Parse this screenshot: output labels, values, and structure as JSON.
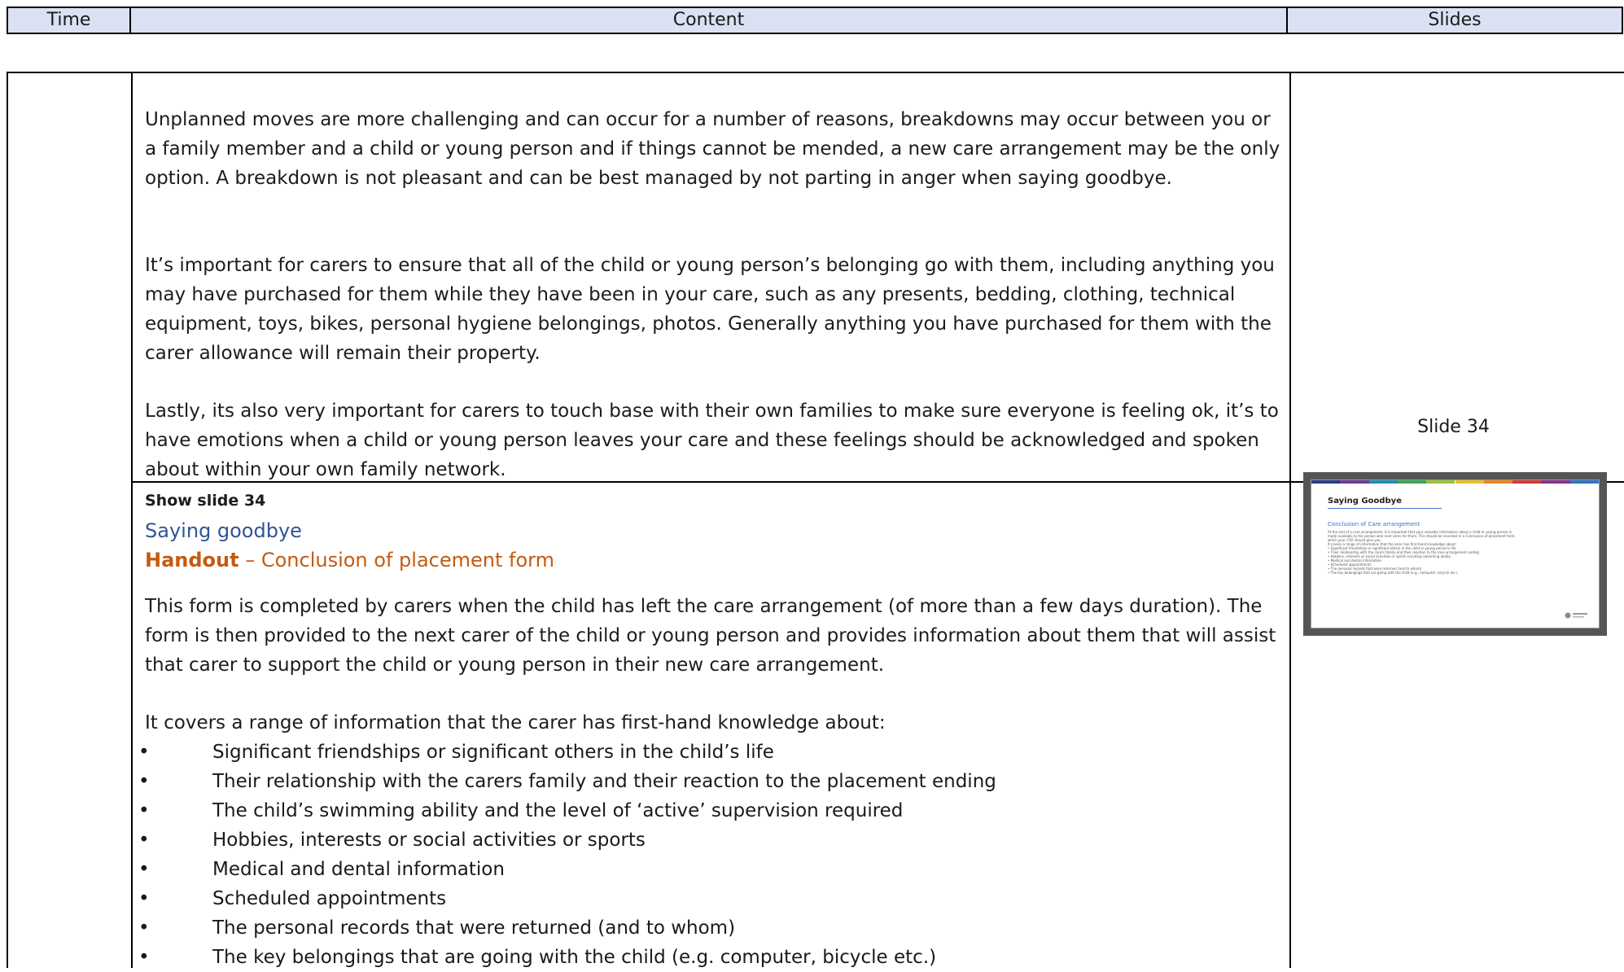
{
  "header": {
    "time": "Time",
    "content": "Content",
    "slides": "Slides"
  },
  "row1": {
    "p1": "Unplanned moves are more challenging and can occur for a number of reasons, breakdowns may occur between you or a family member and a child or young person and if things cannot be mended, a new care arrangement may be the only option.  A breakdown is not pleasant and can be best managed by not parting in anger when saying goodbye.",
    "p2": "It’s important for carers to ensure that all of the child or young person’s belonging go with them, including anything you may have purchased for them while they have been in your care, such as any presents, bedding, clothing, technical equipment, toys, bikes, personal hygiene belongings, photos. Generally anything you have purchased for them with the carer allowance will remain their property.",
    "p3": "Lastly, its also very important for carers to touch base with their own families to make sure everyone is feeling ok, it’s to have emotions when a child or young person leaves your care and these feelings should be acknowledged and spoken about within your own family network."
  },
  "row2": {
    "show": "Show slide 34",
    "subtitle": "Saying goodbye",
    "handout_label": "Handout",
    "handout_rest": " – Conclusion of placement form",
    "p1": "This form is completed by carers when the child has left the care arrangement (of more than a few days duration). The form is then provided to the next carer of the child or young person and provides information about them that will assist that carer to support the child or young person in their new care arrangement.",
    "p2": "It covers a range of information that the carer has first-hand knowledge about:",
    "bullets": [
      "Significant friendships or significant others in the child’s life",
      "Their relationship with the carers family and their reaction to the placement ending",
      "The child’s swimming ability and the level of ‘active’ supervision required",
      "Hobbies, interests or social activities or sports",
      "Medical and dental information",
      "Scheduled appointments",
      "The personal records that were returned (and to whom)",
      "The key belongings that are going with the child (e.g. computer, bicycle etc.)"
    ],
    "bullet_glyph": "•",
    "slide_label": "Slide 34"
  },
  "thumbnail": {
    "title": "Saying Goodbye",
    "subtitle": "Conclusion of Care arrangement",
    "body": [
      "At the end of a care arrangement, it is important that your valuable information about a child or young person is",
      "made available to the person who next cares for them. This should be recorded in a Conclusion of placement form,",
      "which your CSO should give you.",
      "",
      "It covers a range of information that the carer has first-hand knowledge about:",
      "  •  Significant friendships or significant others in the child or young person's life",
      "  •  Their relationship with the carers family and their reaction to the care arrangement ending",
      "  •  Hobbies, interests or social activities or sports including swimming ability",
      "  •  Medical and dental information",
      "  •  Scheduled appointments",
      "  •  The personal records that were returned (and to whom)",
      "  •  The key belongings that are going with the child (e.g., computer, bicycle etc.)"
    ],
    "logo_text": "Queensland Government",
    "stripe_colors": [
      "#2e3a87",
      "#6a3d9a",
      "#1f8fb5",
      "#3aa655",
      "#9bc13c",
      "#e5c02c",
      "#e8862a",
      "#d13b3b",
      "#8b2f8f",
      "#2f73c8"
    ]
  },
  "colors": {
    "header_bg": "#dae1f3",
    "subtitle": "#2f5597",
    "handout": "#c55a11"
  }
}
